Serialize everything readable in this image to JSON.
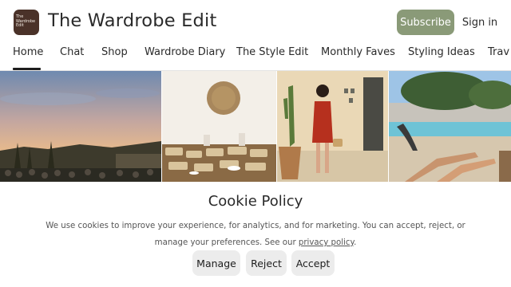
{
  "header": {
    "logo_text": [
      "The",
      "Wardrobe",
      "Edit"
    ],
    "title": "The Wardrobe Edit",
    "subscribe_label": "Subscribe",
    "signin_label": "Sign in"
  },
  "nav": {
    "items": [
      {
        "label": "Home",
        "active": true
      },
      {
        "label": "Chat"
      },
      {
        "label": "Shop"
      },
      {
        "label": "Wardrobe Diary"
      },
      {
        "label": "The Style Edit"
      },
      {
        "label": "Monthly Faves"
      },
      {
        "label": "Styling Ideas"
      },
      {
        "label": "Trav"
      }
    ]
  },
  "photos": [
    {
      "name": "sunset-trees-photo"
    },
    {
      "name": "brunch-buffet-photo"
    },
    {
      "name": "red-dress-woman-photo"
    },
    {
      "name": "poolside-legs-photo"
    }
  ],
  "cookie": {
    "title": "Cookie Policy",
    "text_part1": "We use cookies to improve your experience, for analytics, and for marketing. You can accept, reject, or manage your preferences. See our ",
    "link_label": "privacy policy",
    "text_part2": ".",
    "manage_label": "Manage",
    "reject_label": "Reject",
    "accept_label": "Accept"
  },
  "colors": {
    "brand_logo": "#4a3229",
    "subscribe_button": "#8a9a78",
    "cookie_button": "#ececec"
  }
}
